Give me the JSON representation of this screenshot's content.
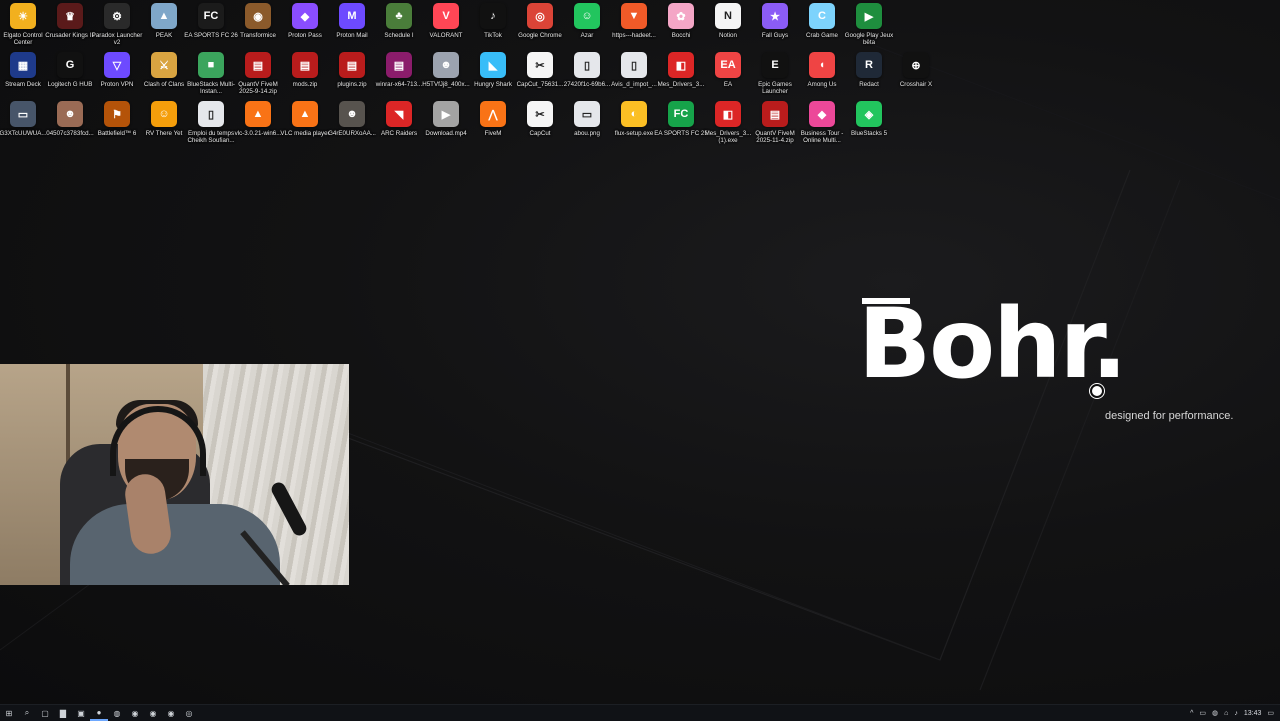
{
  "desktop": {
    "rows": [
      [
        {
          "label": "Elgato Control Center",
          "glyph": "☀",
          "color": "#f2b01e"
        },
        {
          "label": "Crusader Kings III",
          "glyph": "♛",
          "color": "#5a1a1a"
        },
        {
          "label": "Paradox Launcher v2",
          "glyph": "⚙",
          "color": "#2a2a2a"
        },
        {
          "label": "PEAK",
          "glyph": "▲",
          "color": "#7fa7c9"
        },
        {
          "label": "EA SPORTS FC 26",
          "glyph": "FC",
          "color": "#1b1b1b"
        },
        {
          "label": "Transformice",
          "glyph": "◉",
          "color": "#8b5a2b"
        },
        {
          "label": "Proton Pass",
          "glyph": "◆",
          "color": "#8a4dff"
        },
        {
          "label": "Proton Mail",
          "glyph": "M",
          "color": "#6d4aff"
        },
        {
          "label": "Schedule I",
          "glyph": "♣",
          "color": "#4a7d3a"
        },
        {
          "label": "VALORANT",
          "glyph": "V",
          "color": "#ff4655"
        },
        {
          "label": "TikTok",
          "glyph": "♪",
          "color": "#111111"
        },
        {
          "label": "Google Chrome",
          "glyph": "◎",
          "color": "#db4437"
        },
        {
          "label": "Azar",
          "glyph": "☺",
          "color": "#22c55e"
        },
        {
          "label": "https---hadeet...",
          "glyph": "▼",
          "color": "#f05a28"
        },
        {
          "label": "Bocchi",
          "glyph": "✿",
          "color": "#f4a6c6"
        },
        {
          "label": "Notion",
          "glyph": "N",
          "color": "#f5f5f5"
        },
        {
          "label": "Fall Guys",
          "glyph": "★",
          "color": "#8b5cf6"
        },
        {
          "label": "Crab Game",
          "glyph": "C",
          "color": "#7dd3fc"
        },
        {
          "label": "Google Play Jeux bêta",
          "glyph": "▶",
          "color": "#1e8e3e"
        }
      ],
      [
        {
          "label": "Stream Deck",
          "glyph": "▦",
          "color": "#1e3a8a"
        },
        {
          "label": "Logitech G HUB",
          "glyph": "G",
          "color": "#111111"
        },
        {
          "label": "Proton VPN",
          "glyph": "▽",
          "color": "#6d4aff"
        },
        {
          "label": "Clash of Clans",
          "glyph": "⚔",
          "color": "#d9a441"
        },
        {
          "label": "BlueStacks Multi-Instan...",
          "glyph": "■",
          "color": "#3ba55d"
        },
        {
          "label": "QuantV FiveM 2025-9-14.zip",
          "glyph": "▤",
          "color": "#b91c1c"
        },
        {
          "label": "mods.zip",
          "glyph": "▤",
          "color": "#b91c1c"
        },
        {
          "label": "plugins.zip",
          "glyph": "▤",
          "color": "#b91c1c"
        },
        {
          "label": "winrar-x64-713...",
          "glyph": "▤",
          "color": "#8b1c6b"
        },
        {
          "label": "H5TVfJj8_400x...",
          "glyph": "☻",
          "color": "#9ca3af"
        },
        {
          "label": "Hungry Shark",
          "glyph": "◣",
          "color": "#38bdf8"
        },
        {
          "label": "CapCut_75631...",
          "glyph": "✂",
          "color": "#f5f5f5"
        },
        {
          "label": "27420f1c-69b6...",
          "glyph": "▯",
          "color": "#e5e7eb"
        },
        {
          "label": "Avis_d_impot_...",
          "glyph": "▯",
          "color": "#e5e7eb"
        },
        {
          "label": "Mes_Drivers_3...",
          "glyph": "◧",
          "color": "#dc2626"
        },
        {
          "label": "EA",
          "glyph": "EA",
          "color": "#ef4444"
        },
        {
          "label": "Epic Games Launcher",
          "glyph": "E",
          "color": "#111111"
        },
        {
          "label": "Among Us",
          "glyph": "◖",
          "color": "#ef4444"
        },
        {
          "label": "Redact",
          "glyph": "R",
          "color": "#1f2937"
        },
        {
          "label": "Crosshair X",
          "glyph": "⊕",
          "color": "#111111"
        }
      ],
      [
        {
          "label": "G3XTcUUWUA...",
          "glyph": "▭",
          "color": "#475569"
        },
        {
          "label": "04507c3783fcd...",
          "glyph": "☻",
          "color": "#9a6b55"
        },
        {
          "label": "Battlefield™ 6",
          "glyph": "⚑",
          "color": "#b45309"
        },
        {
          "label": "RV There Yet",
          "glyph": "☺",
          "color": "#f59e0b"
        },
        {
          "label": "Emploi du temps Cheikh Soufian...",
          "glyph": "▯",
          "color": "#e5e7eb"
        },
        {
          "label": "vlc-3.0.21-win6...",
          "glyph": "▲",
          "color": "#f97316"
        },
        {
          "label": "VLC media player",
          "glyph": "▲",
          "color": "#f97316"
        },
        {
          "label": "G4rE0URXoAA...",
          "glyph": "☻",
          "color": "#57534e"
        },
        {
          "label": "ARC Raiders",
          "glyph": "◥",
          "color": "#dc2626"
        },
        {
          "label": "Download.mp4",
          "glyph": "▶",
          "color": "#a3a3a3"
        },
        {
          "label": "FiveM",
          "glyph": "⋀",
          "color": "#f97316"
        },
        {
          "label": "CapCut",
          "glyph": "✂",
          "color": "#f5f5f5"
        },
        {
          "label": "abou.png",
          "glyph": "▭",
          "color": "#e5e7eb"
        },
        {
          "label": "flux-setup.exe",
          "glyph": "◐",
          "color": "#fbbf24"
        },
        {
          "label": "EA SPORTS FC 25",
          "glyph": "FC",
          "color": "#16a34a"
        },
        {
          "label": "Mes_Drivers_3... (1).exe",
          "glyph": "◧",
          "color": "#dc2626"
        },
        {
          "label": "QuantV FiveM 2025-11-4.zip",
          "glyph": "▤",
          "color": "#b91c1c"
        },
        {
          "label": "Business Tour - Online Multi...",
          "glyph": "◆",
          "color": "#ec4899"
        },
        {
          "label": "BlueStacks 5",
          "glyph": "◈",
          "color": "#22c55e"
        }
      ]
    ]
  },
  "brand": {
    "logo": "Bohr.",
    "tagline": "designed for performance."
  },
  "taskbar": {
    "buttons": [
      {
        "name": "start-button",
        "glyph": "⊞"
      },
      {
        "name": "search-icon",
        "glyph": "⌕"
      },
      {
        "name": "task-view-icon",
        "glyph": "▢"
      },
      {
        "name": "file-explorer-icon",
        "glyph": "▇"
      },
      {
        "name": "store-icon",
        "glyph": "▣"
      },
      {
        "name": "app-icon",
        "glyph": "●"
      },
      {
        "name": "edge-icon",
        "glyph": "◍"
      },
      {
        "name": "whatsapp-icon",
        "glyph": "◉"
      },
      {
        "name": "spotify-icon",
        "glyph": "◉"
      },
      {
        "name": "discord-icon",
        "glyph": "◉"
      },
      {
        "name": "steam-icon",
        "glyph": "◎"
      }
    ],
    "tray": {
      "chevron": "^",
      "icons": [
        "▭",
        "◍",
        "⌂",
        "♪"
      ],
      "time": "13:43"
    }
  },
  "colors": {
    "accent": "#6ea8fe",
    "background": "#0f0f10"
  }
}
